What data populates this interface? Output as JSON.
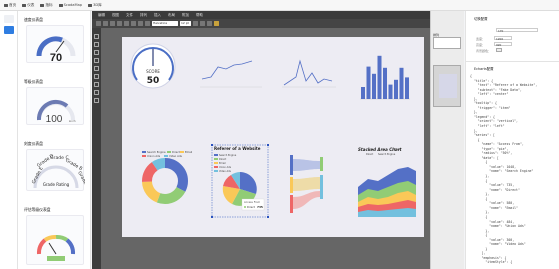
{
  "topbar": {
    "tabs": [
      {
        "label": "首页"
      },
      {
        "label": "仪表"
      },
      {
        "label": "指标"
      },
      {
        "label": "ScadaMap"
      },
      {
        "label": "3D库"
      }
    ]
  },
  "widget_panel": {
    "sections": [
      {
        "title": "速度仪表盘"
      },
      {
        "title": "等级仪表盘"
      },
      {
        "title": "刻度仪表盘"
      },
      {
        "title": "评估等级仪表盘"
      }
    ],
    "gauge1": {
      "value": "70"
    },
    "gauge2": {
      "value": "100",
      "unit": "km/h"
    },
    "gauge3": {
      "arc_labels": [
        "Grade E",
        "Grade D",
        "Grade C",
        "Grade B",
        "Grade A"
      ],
      "caption": "Grade Rating"
    }
  },
  "editor": {
    "menu": [
      "编辑",
      "视图",
      "文件",
      "排列",
      "插入",
      "布局",
      "附加",
      "帮助"
    ],
    "font": "Helvetica",
    "font_size": "12 pt",
    "gauge": {
      "value": "50",
      "caption": "SCORE"
    },
    "bar_chart": {
      "type": "bar",
      "values": [
        20,
        54,
        42,
        72,
        52,
        24,
        32,
        52,
        36
      ],
      "ylim": [
        0,
        80
      ]
    },
    "donut_legend": [
      "Search Engine",
      "Direct",
      "Email",
      "Union Ads",
      "Video Ads"
    ],
    "pie_title": "Referer of a Website",
    "pie_legend": [
      "Search Engine",
      "Direct",
      "Email",
      "Union Ads",
      "Video Ads"
    ],
    "pie_tooltip": {
      "label": "Access From",
      "name": "Direct",
      "value": "735"
    },
    "area_title": "Stacked Area Chart",
    "area_legend": [
      "Email",
      "Union Ads",
      "Video Ads",
      "Direct",
      "Search Engine"
    ]
  },
  "props_panel": {
    "section": "排列"
  },
  "right_panel": {
    "title": "切换配置",
    "width_label": "宽度：",
    "width_value": "1200",
    "height_label": "高度：",
    "height_value": "920",
    "bg_label": "背景颜色：",
    "top_value": "170",
    "json_title": "Echarts配置",
    "code_lines": [
      "{",
      "  \"title\": {",
      "    \"text\": \"Referer of a Website\",",
      "    \"subtext\": \"Fake Data\",",
      "    \"left\": \"center\"",
      "  },",
      "  \"tooltip\": {",
      "    \"trigger\": \"item\"",
      "  },",
      "  \"legend\": {",
      "    \"orient\": \"vertical\",",
      "    \"left\": \"left\"",
      "  },",
      "  \"series\": [",
      "    {",
      "      \"name\": \"Access From\",",
      "      \"type\": \"pie\",",
      "      \"radius\": \"50%\",",
      "      \"data\": [",
      "        {",
      "          \"value\": 1048,",
      "          \"name\": \"Search Engine\"",
      "        },",
      "        {",
      "          \"value\": 735,",
      "          \"name\": \"Direct\"",
      "        },",
      "        {",
      "          \"value\": 580,",
      "          \"name\": \"Email\"",
      "        },",
      "        {",
      "          \"value\": 484,",
      "          \"name\": \"Union Ads\"",
      "        },",
      "        {",
      "          \"value\": 300,",
      "          \"name\": \"Video Ads\"",
      "        }",
      "      ],",
      "      \"emphasis\": {",
      "        \"itemStyle\": {"
    ]
  },
  "colors": {
    "accent": "#4a6ec5",
    "echarts_blue": "#5470c6",
    "echarts_green": "#91cc75",
    "echarts_yellow": "#fac858",
    "echarts_red": "#ee6666",
    "echarts_cyan": "#73c0de",
    "editor_dark": "#3b3b3b"
  }
}
